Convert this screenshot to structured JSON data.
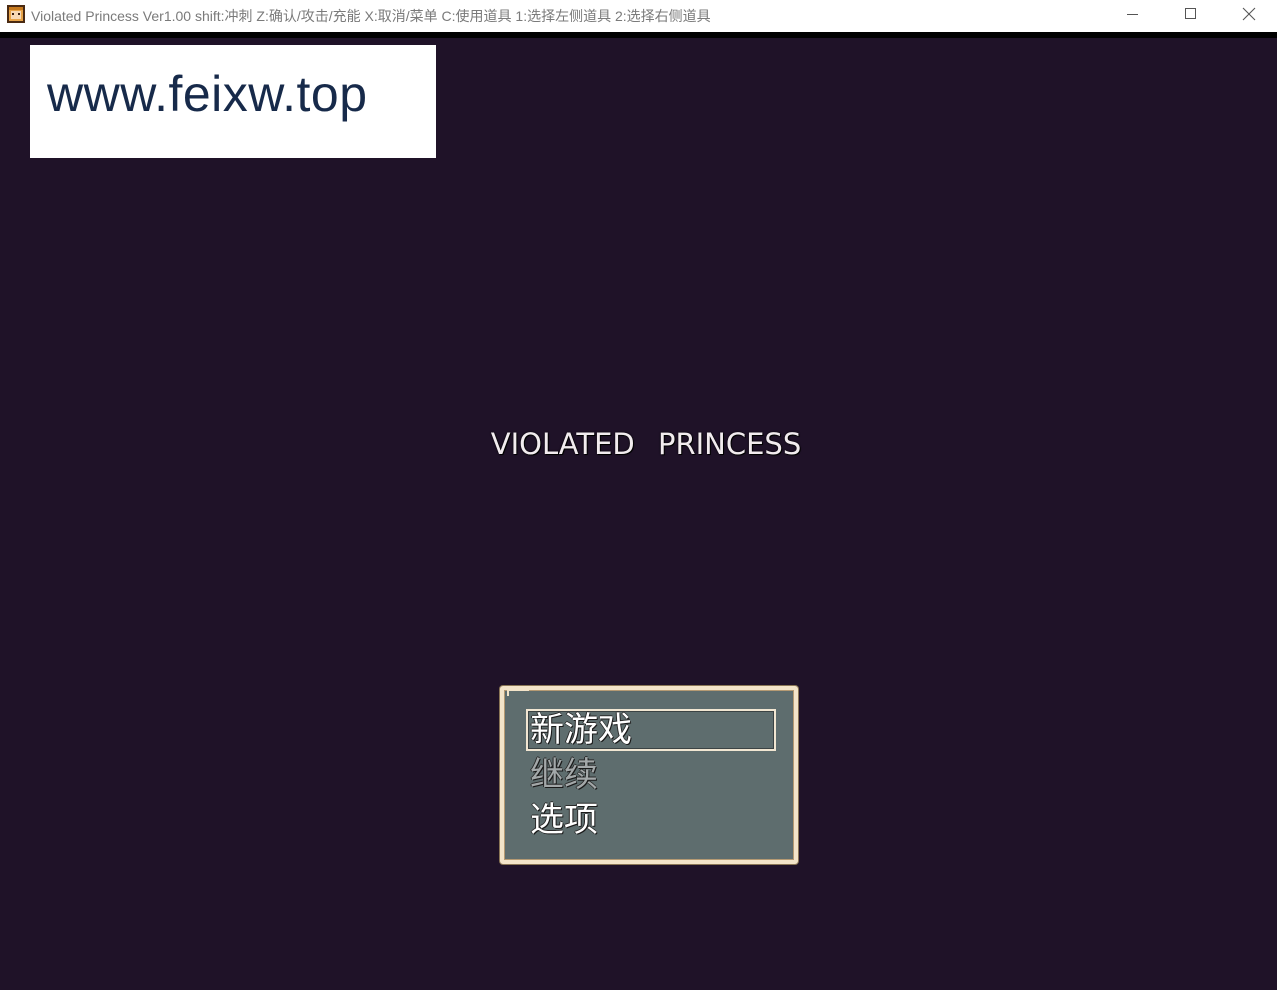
{
  "window": {
    "title": "Violated Princess Ver1.00 shift:冲刺 Z:确认/攻击/充能 X:取消/菜单 C:使用道具 1:选择左侧道具 2:选择右侧道具",
    "icon": "app-icon",
    "controls": [
      "minimize-icon",
      "maximize-icon",
      "close-icon"
    ]
  },
  "watermark": {
    "text": "www.feixw.top"
  },
  "game": {
    "title": "VIOLATED PRINCESS",
    "background_color": "#1f1228"
  },
  "menu": {
    "items": [
      {
        "label": "新游戏",
        "selected": true,
        "enabled": true
      },
      {
        "label": "继续",
        "selected": false,
        "enabled": false
      },
      {
        "label": "选项",
        "selected": false,
        "enabled": true
      }
    ]
  }
}
